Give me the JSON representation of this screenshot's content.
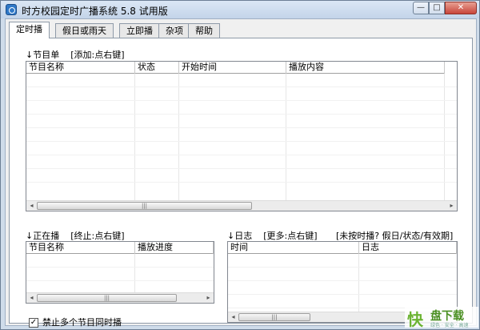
{
  "window": {
    "title": "时方校园定时广播系统 5.8 试用版",
    "minimize_glyph": "—",
    "maximize_glyph": "□",
    "close_glyph": "✕"
  },
  "tabs": [
    {
      "label": "定时播",
      "active": true
    },
    {
      "label": "假日或雨天",
      "active": false
    },
    {
      "label": "立即播",
      "active": false
    },
    {
      "label": "杂项",
      "active": false
    },
    {
      "label": "帮助",
      "active": false
    }
  ],
  "program_list": {
    "label": "↓节目单",
    "hint": "[添加:点右键]",
    "columns": [
      "节目名称",
      "状态",
      "开始时间",
      "播放内容"
    ]
  },
  "now_playing": {
    "label": "↓正在播",
    "hint": "[终止:点右键]",
    "columns": [
      "节目名称",
      "播放进度"
    ]
  },
  "log": {
    "label": "↓日志",
    "hint": "[更多:点右键]",
    "hint2": "[未按时播? 假日/状态/有效期]",
    "columns": [
      "时间",
      "日志"
    ]
  },
  "options": {
    "forbid_concurrent_label": "禁止多个节目同时播",
    "forbid_concurrent_checked": "✓"
  },
  "scroll": {
    "left_arrow": "◂",
    "right_arrow": "▸",
    "thumb_grip": "|||"
  },
  "watermark": {
    "mark": "快",
    "text": "盘下载",
    "sub": "绿色 · 安全 · 高速"
  }
}
